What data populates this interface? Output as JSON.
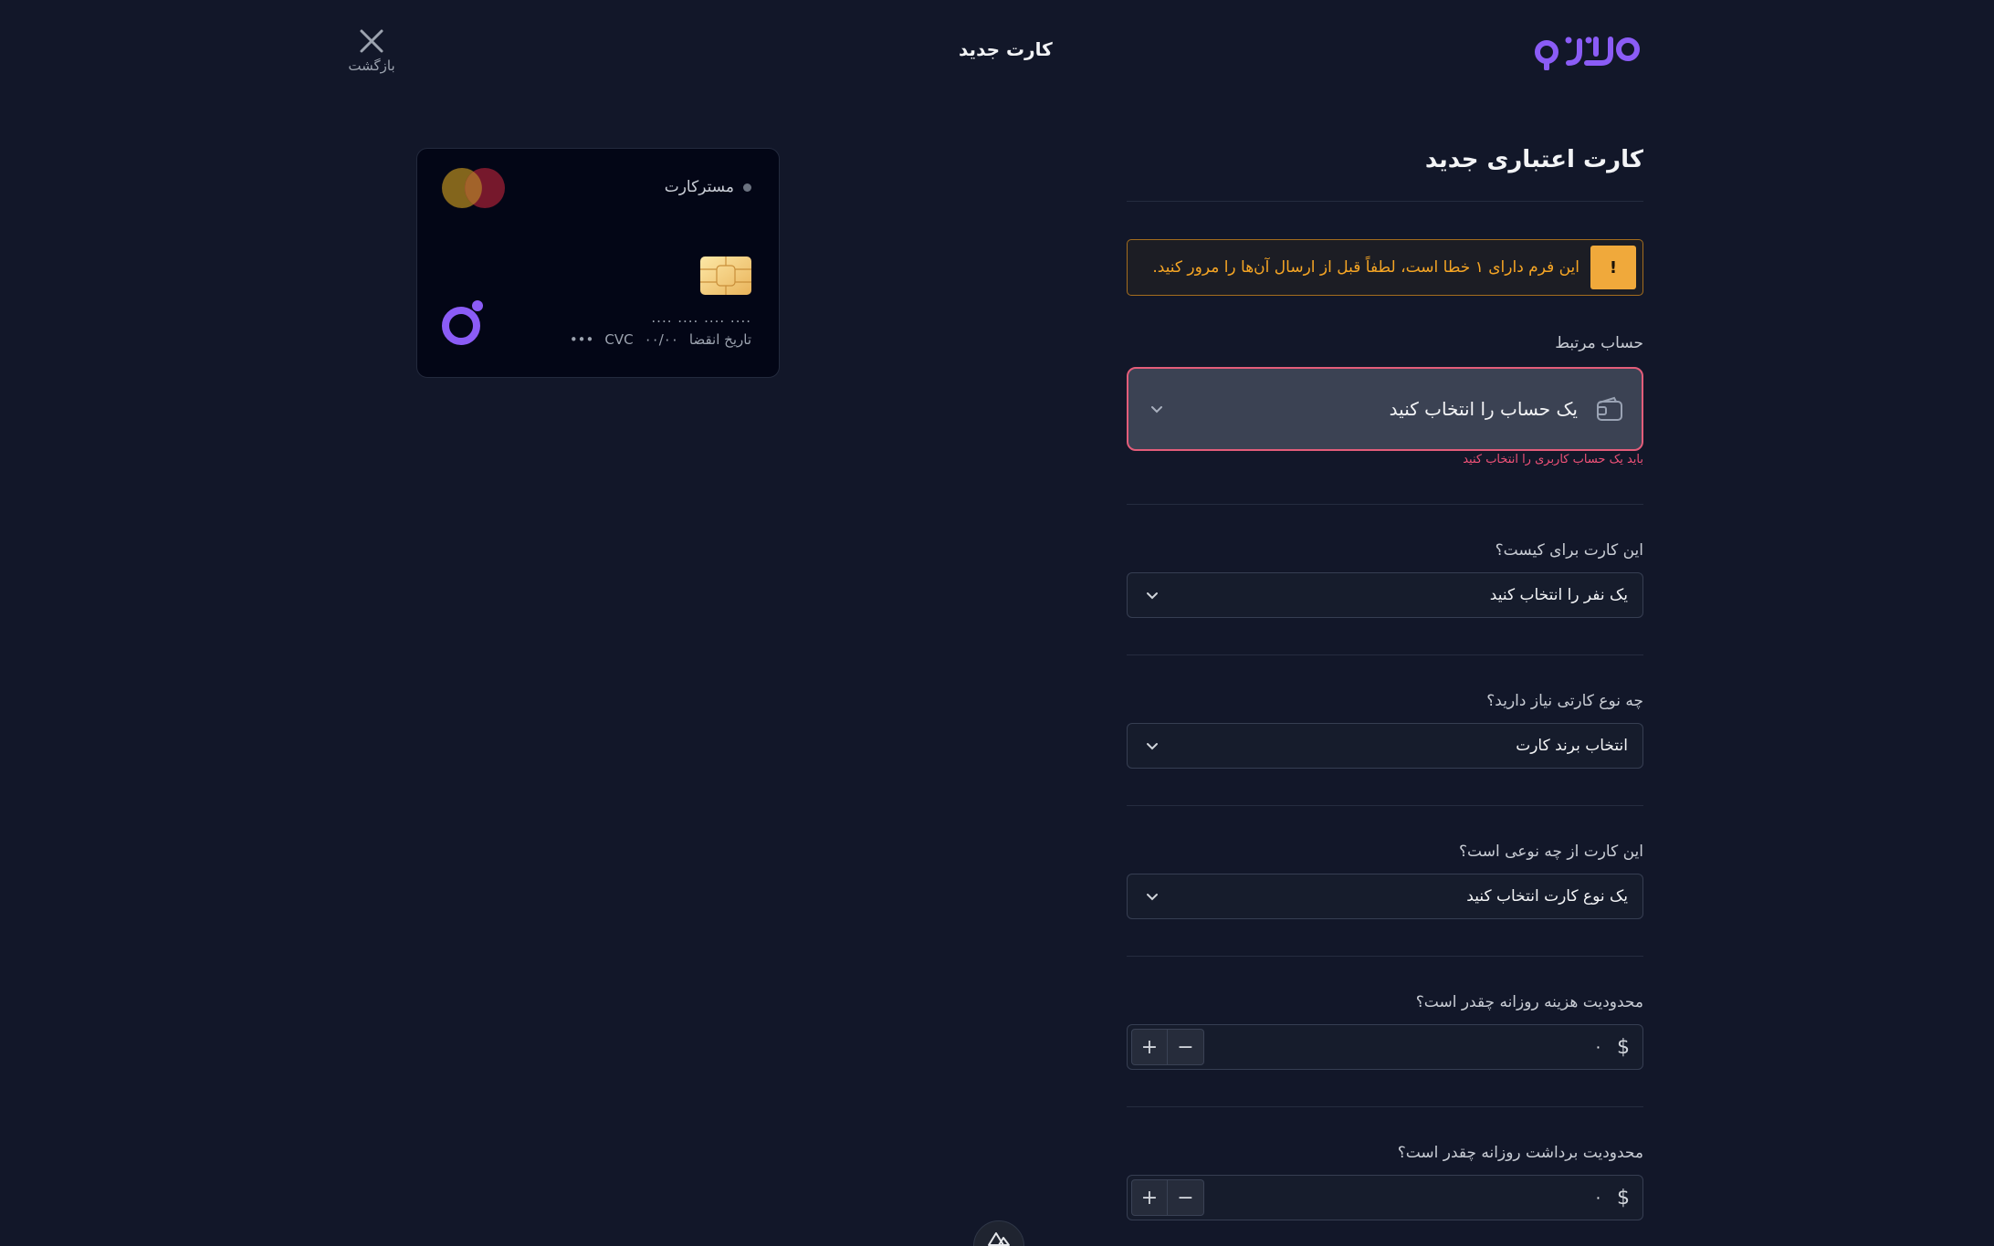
{
  "header": {
    "title": "کارت جدید",
    "back_label": "بازگشت",
    "logo_icon": "brand-logo"
  },
  "card_preview": {
    "brand": "مسترکارت",
    "number": ".... .... .... ....",
    "expiry_label": "تاریخ انقضا",
    "expiry": "۰۰/۰۰",
    "cvc_label": "CVC",
    "cvc": "•••"
  },
  "form": {
    "title": "کارت اعتباری جدید",
    "alert": {
      "icon": "!",
      "message": "این فرم دارای ۱ خطا است، لطفاً قبل از ارسال آن‌ها را مرور کنید."
    },
    "account": {
      "label": "حساب مرتبط",
      "placeholder": "یک حساب را انتخاب کنید",
      "error": "باید یک حساب کاربری را انتخاب کنید"
    },
    "cardholder": {
      "label": "این کارت برای کیست؟",
      "placeholder": "یک نفر را انتخاب کنید"
    },
    "brand": {
      "label": "چه نوع کارتی نیاز دارید؟",
      "placeholder": "انتخاب برند کارت"
    },
    "card_type": {
      "label": "این کارت از چه نوعی است؟",
      "placeholder": "یک نوع کارت انتخاب کنید"
    },
    "daily_spend": {
      "label": "محدودیت هزینه روزانه چقدر است؟",
      "currency": "$",
      "value": "۰",
      "plus": "+",
      "minus": "−"
    },
    "daily_withdraw": {
      "label": "محدودیت برداشت روزانه چقدر است؟",
      "currency": "$",
      "value": "۰",
      "plus": "+",
      "minus": "−"
    }
  },
  "colors": {
    "background": "#121729",
    "accent": "#8b5cf6",
    "warning": "#f5a524",
    "error": "#f05278"
  }
}
